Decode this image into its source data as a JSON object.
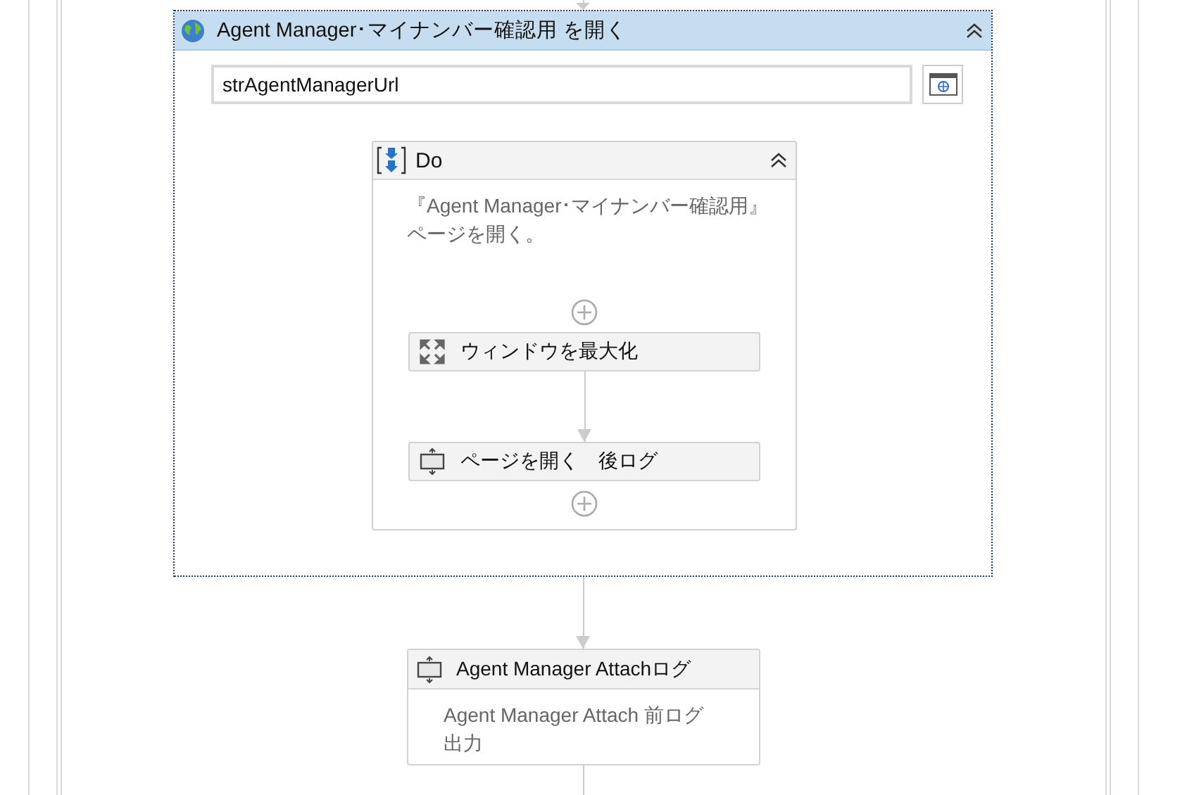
{
  "scope": {
    "title": "Agent Manager･マイナンバー確認用 を開く",
    "url_field": {
      "value": "strAgentManagerUrl"
    },
    "sequence": {
      "title": "Do",
      "annotation_lines": [
        "『Agent Manager･マイナンバー確認用』",
        "ページを開く。"
      ],
      "activities": [
        {
          "kind": "maximize",
          "title": "ウィンドウを最大化"
        },
        {
          "kind": "log",
          "title": "ページを開く　後ログ"
        }
      ]
    }
  },
  "after": [
    {
      "kind": "log",
      "title": "Agent Manager Attachログ",
      "annotation_lines": [
        "Agent Manager Attach 前ログ",
        "出力"
      ]
    }
  ]
}
